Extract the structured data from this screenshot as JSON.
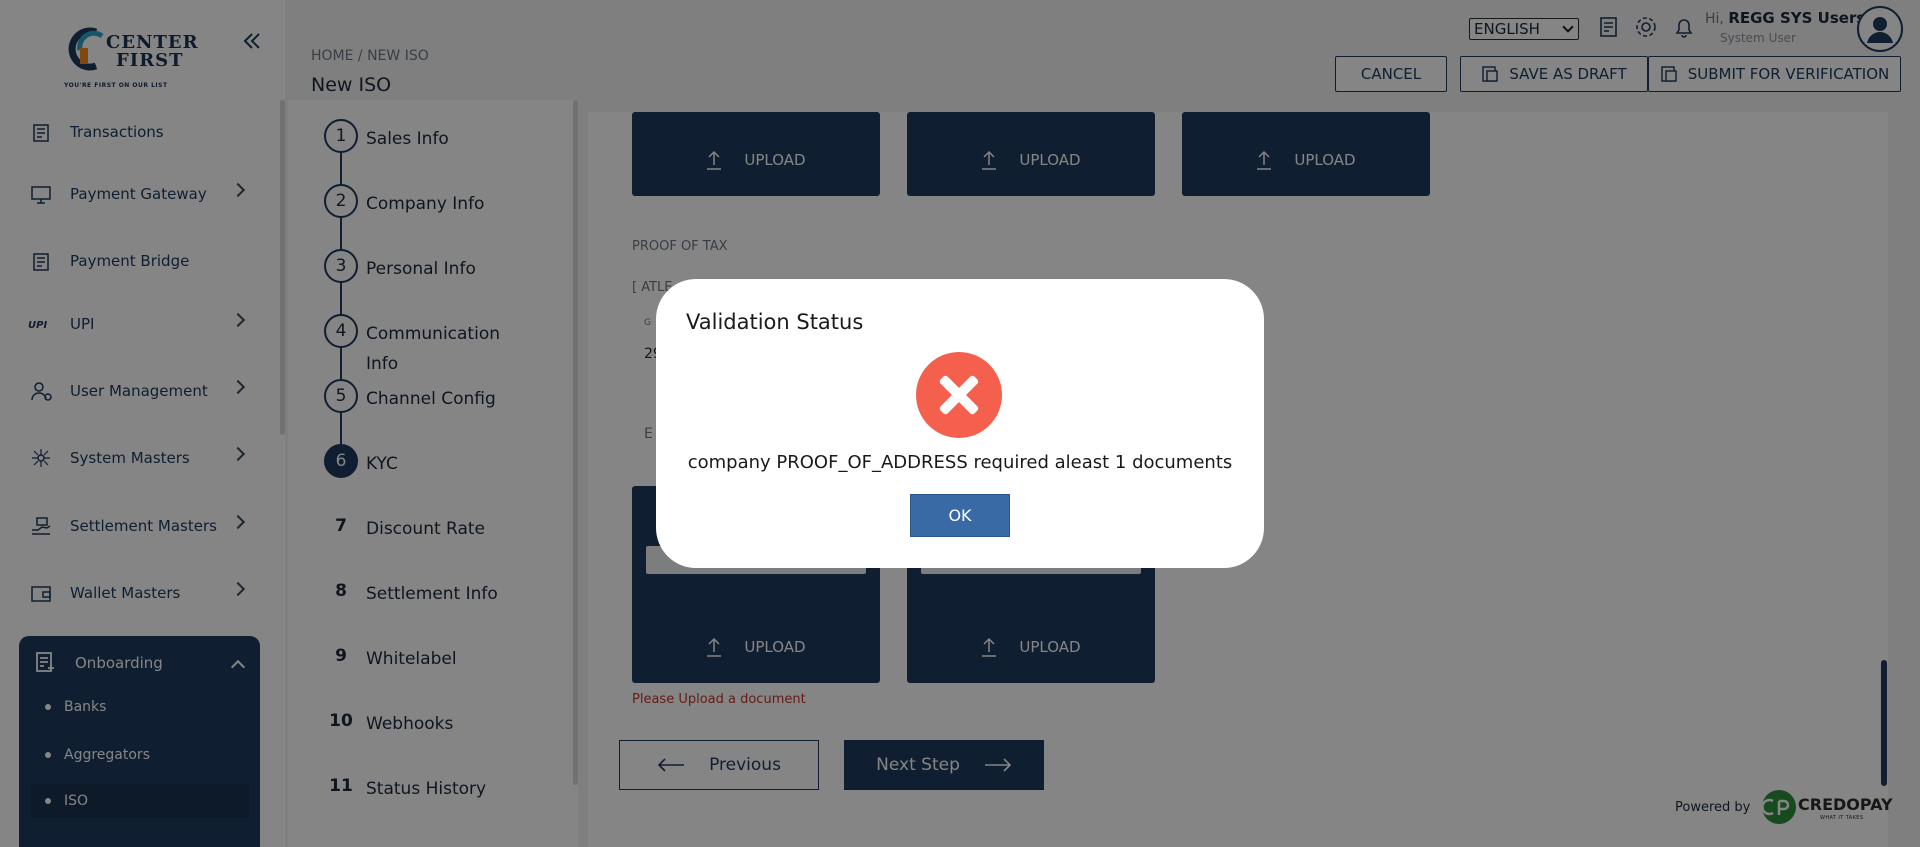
{
  "brand": {
    "logo_line1": "CENTER",
    "logo_line2": "FIRST",
    "tagline": "YOU'RE FIRST ON OUR LIST"
  },
  "sidebar": {
    "items": [
      {
        "label": "Transactions",
        "icon": "transactions-icon",
        "has_children": false
      },
      {
        "label": "Payment Gateway",
        "icon": "payment-gateway-icon",
        "has_children": true
      },
      {
        "label": "Payment Bridge",
        "icon": "payment-bridge-icon",
        "has_children": false
      },
      {
        "label": "UPI",
        "icon": "upi-icon",
        "has_children": true
      },
      {
        "label": "User Management",
        "icon": "user-management-icon",
        "has_children": true
      },
      {
        "label": "System Masters",
        "icon": "system-masters-icon",
        "has_children": true
      },
      {
        "label": "Settlement Masters",
        "icon": "settlement-masters-icon",
        "has_children": true
      },
      {
        "label": "Wallet Masters",
        "icon": "wallet-masters-icon",
        "has_children": true
      }
    ],
    "onboarding": {
      "label": "Onboarding",
      "items": [
        "Banks",
        "Aggregators",
        "ISO"
      ],
      "active": "ISO"
    }
  },
  "header": {
    "breadcrumb": "HOME / NEW ISO",
    "title": "New ISO",
    "language": "ENGLISH",
    "greeting_prefix": "Hi,",
    "user_name": "REGG SYS Users",
    "user_role": "System User",
    "cancel_label": "CANCEL",
    "save_draft_label": "SAVE AS DRAFT",
    "submit_label": "SUBMIT FOR VERIFICATION"
  },
  "steps": [
    {
      "num": "1",
      "label": "Sales Info"
    },
    {
      "num": "2",
      "label": "Company Info"
    },
    {
      "num": "3",
      "label": "Personal Info"
    },
    {
      "num": "4",
      "label": "Communication Info"
    },
    {
      "num": "5",
      "label": "Channel Config"
    },
    {
      "num": "6",
      "label": "KYC"
    },
    {
      "num": "7",
      "label": "Discount Rate"
    },
    {
      "num": "8",
      "label": "Settlement Info"
    },
    {
      "num": "9",
      "label": "Whitelabel"
    },
    {
      "num": "10",
      "label": "Webhooks"
    },
    {
      "num": "11",
      "label": "Status History"
    }
  ],
  "active_step": "6",
  "main": {
    "upload_label": "UPLOAD",
    "proof_of_tax_label": "PROOF OF TAX",
    "atleast_label": "[ ATLE",
    "partial_field_label": "G",
    "partial_field_value": "29",
    "partial_e_label": "E",
    "error_text": "Please Upload a document",
    "previous_label": "Previous",
    "next_label": "Next Step"
  },
  "footer": {
    "powered_by": "Powered by",
    "credopay": "CREDOPAY",
    "credopay_tag": "WHAT IT TAKES"
  },
  "modal": {
    "title": "Validation Status",
    "message": "company PROOF_OF_ADDRESS required aleast 1 documents",
    "ok_label": "OK"
  },
  "colors": {
    "primary": "#1d3a5c",
    "error": "#f4604d",
    "ok_button": "#3a6aa6"
  }
}
